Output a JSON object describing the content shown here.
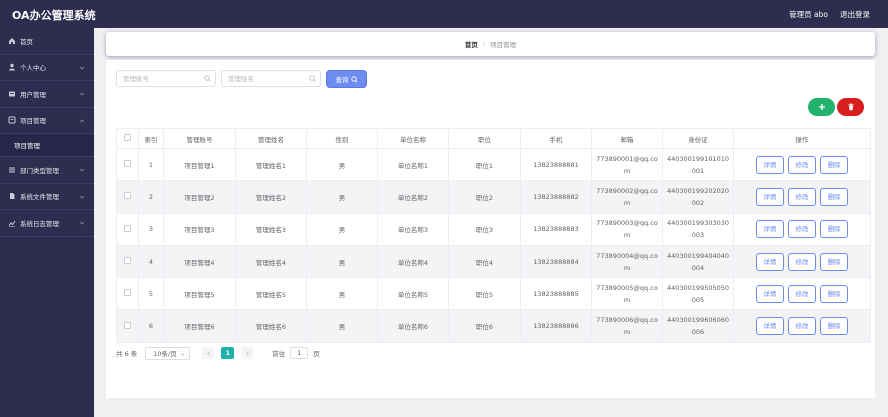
{
  "header": {
    "app_title": "OA办公管理系统",
    "user_label": "管理员 abo",
    "logout_label": "退出登录"
  },
  "sidebar": {
    "items": [
      {
        "label": "首页",
        "icon": "home-icon"
      },
      {
        "label": "个人中心",
        "icon": "user-icon"
      },
      {
        "label": "用户管理",
        "icon": "users-icon"
      },
      {
        "label": "项目管理",
        "icon": "project-icon",
        "expanded": true
      },
      {
        "label": "部门类型管理",
        "icon": "department-icon"
      },
      {
        "label": "系统文件管理",
        "icon": "file-icon"
      },
      {
        "label": "系统日志管理",
        "icon": "log-icon"
      }
    ],
    "sub_item": "项目管理"
  },
  "breadcrumb": {
    "home": "首页",
    "separator": "/",
    "current": "项目管理"
  },
  "search": {
    "account_placeholder": "管理账号",
    "name_placeholder": "管理姓名",
    "query_label": "查询"
  },
  "table": {
    "headers": [
      "索引",
      "管理账号",
      "管理姓名",
      "性别",
      "单位名称",
      "职位",
      "手机",
      "邮箱",
      "身份证",
      "操作"
    ],
    "rows": [
      {
        "index": "1",
        "account": "项目管理1",
        "name": "管理姓名1",
        "gender": "男",
        "unit": "单位名称1",
        "position": "职位1",
        "phone": "13823888881",
        "email": "773890001@qq.com",
        "id_card": "440300199101010001"
      },
      {
        "index": "2",
        "account": "项目管理2",
        "name": "管理姓名2",
        "gender": "男",
        "unit": "单位名称2",
        "position": "职位2",
        "phone": "13823888882",
        "email": "773890002@qq.com",
        "id_card": "440300199202020002"
      },
      {
        "index": "3",
        "account": "项目管理3",
        "name": "管理姓名3",
        "gender": "男",
        "unit": "单位名称3",
        "position": "职位3",
        "phone": "13823888883",
        "email": "773890003@qq.com",
        "id_card": "440300199303030003"
      },
      {
        "index": "4",
        "account": "项目管理4",
        "name": "管理姓名4",
        "gender": "男",
        "unit": "单位名称4",
        "position": "职位4",
        "phone": "13823888884",
        "email": "773890004@qq.com",
        "id_card": "440300199404040004"
      },
      {
        "index": "5",
        "account": "项目管理5",
        "name": "管理姓名5",
        "gender": "男",
        "unit": "单位名称5",
        "position": "职位5",
        "phone": "13823888885",
        "email": "773890005@qq.com",
        "id_card": "440300199505050005"
      },
      {
        "index": "6",
        "account": "项目管理6",
        "name": "管理姓名6",
        "gender": "男",
        "unit": "单位名称6",
        "position": "职位6",
        "phone": "13823888886",
        "email": "773890006@qq.com",
        "id_card": "440300199606060006"
      }
    ],
    "actions": {
      "detail": "详情",
      "edit": "修改",
      "delete": "删除"
    }
  },
  "pagination": {
    "total": "共 6 条",
    "page_size": "10条/页",
    "current_page": "1",
    "goto_label": "前往",
    "goto_value": "1",
    "page_suffix": "页"
  },
  "colors": {
    "sidebar_bg": "#2e2d4f",
    "primary": "#6e8cf0",
    "add": "#23b26d",
    "delete": "#d81e1e",
    "page_active": "#20b2aa"
  }
}
